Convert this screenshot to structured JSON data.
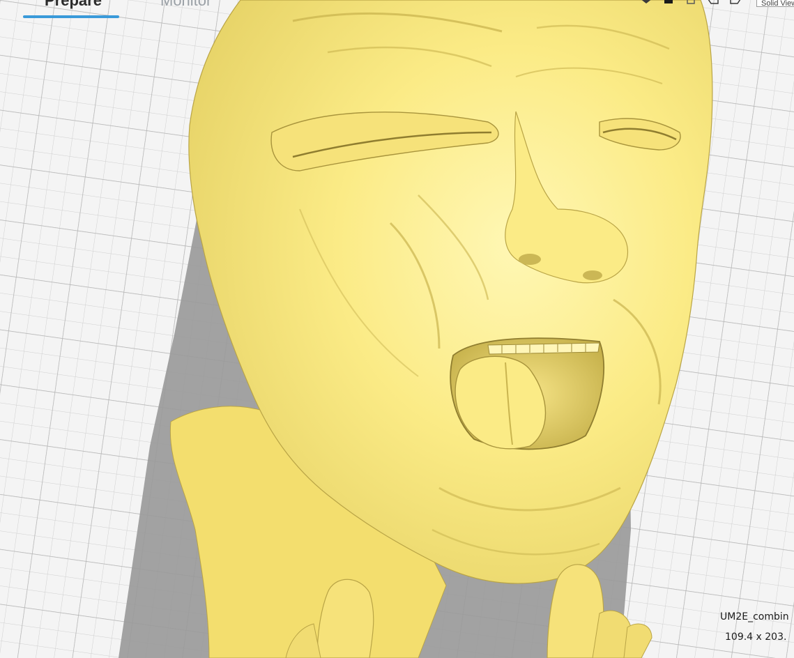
{
  "tabs": {
    "prepare": "Prepare",
    "monitor": "Monitor"
  },
  "toolbar": {
    "view_mode": "Solid View",
    "view_icons": [
      "3d-view-icon",
      "front-view-icon",
      "top-view-icon",
      "left-view-icon",
      "right-view-icon"
    ]
  },
  "object_info": {
    "name": "UM2E_combin",
    "dimensions": "109.4 x 203."
  },
  "colors": {
    "model": "#fbee8e",
    "model_shadow": "#d8c65a",
    "build_plate": "#f4f4f4",
    "grid_line": "#c4c4c4",
    "plate_shadow": "#9a9a9a",
    "tab_accent": "#3a9ad9"
  }
}
